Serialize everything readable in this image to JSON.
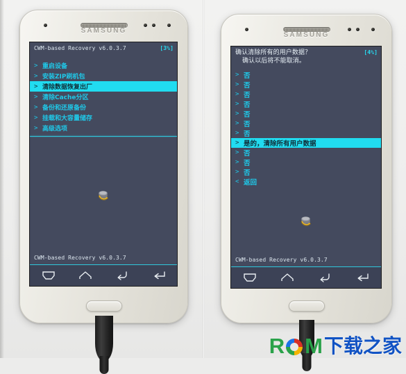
{
  "image": {
    "description": "Two photos of a white Samsung Galaxy phone showing the CWM-based Recovery menu in Chinese",
    "background_color": "#ececeb"
  },
  "device": {
    "brand": "SAMSUNG",
    "icons": {
      "earpiece": "earpiece-grille",
      "sensor": "proximity-sensor-dot",
      "home": "home-button",
      "cable": "usb-cable"
    }
  },
  "left_phone": {
    "screen": {
      "header": {
        "title": "CWM-based Recovery v6.0.3.7",
        "progress": "[3%]"
      },
      "menu": [
        {
          "arrow": ">",
          "label": "重启设备",
          "selected": false
        },
        {
          "arrow": ">",
          "label": "安装ZIP刷机包",
          "selected": false
        },
        {
          "arrow": ">",
          "label": "清除数据恢复出厂",
          "selected": true
        },
        {
          "arrow": ">",
          "label": "清除Cache分区",
          "selected": false
        },
        {
          "arrow": ">",
          "label": "备份和还原备份",
          "selected": false
        },
        {
          "arrow": ">",
          "label": "挂载和大容量储存",
          "selected": false
        },
        {
          "arrow": ">",
          "label": "高级选项",
          "selected": false
        }
      ],
      "footer": "CWM-based Recovery v6.0.3.7",
      "logo": "clockworkmod-logo",
      "navbar": [
        {
          "icon": "menu-icon"
        },
        {
          "icon": "home-icon"
        },
        {
          "icon": "back-icon"
        },
        {
          "icon": "enter-icon"
        }
      ]
    }
  },
  "right_phone": {
    "screen": {
      "header": {
        "line1": "确认清除所有的用户数据？",
        "line2": "确认以后将不能取消。",
        "progress": "[4%]"
      },
      "menu": [
        {
          "arrow": ">",
          "label": "否",
          "selected": false
        },
        {
          "arrow": ">",
          "label": "否",
          "selected": false
        },
        {
          "arrow": ">",
          "label": "否",
          "selected": false
        },
        {
          "arrow": ">",
          "label": "否",
          "selected": false
        },
        {
          "arrow": ">",
          "label": "否",
          "selected": false
        },
        {
          "arrow": ">",
          "label": "否",
          "selected": false
        },
        {
          "arrow": ">",
          "label": "否",
          "selected": false
        },
        {
          "arrow": ">",
          "label": "是的，清除所有用户数据",
          "selected": true
        },
        {
          "arrow": ">",
          "label": "否",
          "selected": false
        },
        {
          "arrow": ">",
          "label": "否",
          "selected": false
        },
        {
          "arrow": ">",
          "label": "否",
          "selected": false
        },
        {
          "arrow": "<",
          "label": "返回",
          "selected": false
        }
      ],
      "footer": "CWM-based Recovery v6.0.3.7",
      "logo": "clockworkmod-logo",
      "navbar": [
        {
          "icon": "menu-icon"
        },
        {
          "icon": "home-icon"
        },
        {
          "icon": "back-icon"
        },
        {
          "icon": "enter-icon"
        }
      ]
    }
  },
  "watermark": {
    "letters": [
      {
        "char": "R",
        "color": "#2aa24a"
      },
      {
        "char": "O",
        "color": "#f4b400"
      },
      {
        "char": "M",
        "color": "#2aa24a"
      }
    ],
    "text_cn": "下载之家",
    "text_cn_color": "#1153c4"
  },
  "colors": {
    "screen_bg": "#444a5e",
    "accent_cyan": "#21dcf0",
    "menu_text": "#1fc8e8",
    "selected_text": "#10303a"
  }
}
